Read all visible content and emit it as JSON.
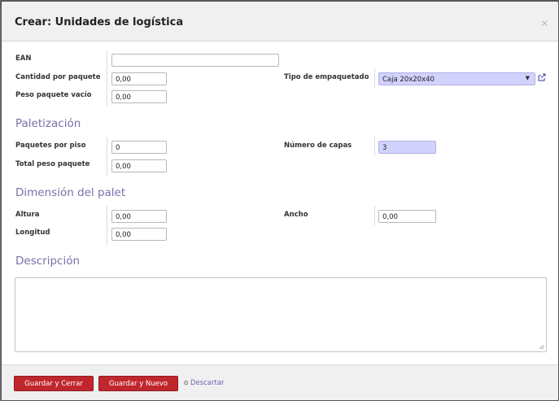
{
  "dialog": {
    "title": "Crear: Unidades de logística",
    "close_label": "×"
  },
  "fields": {
    "ean": {
      "label": "EAN",
      "value": ""
    },
    "cantidad_por_paquete": {
      "label": "Cantidad por paquete",
      "value": "0,00"
    },
    "peso_paquete_vacio": {
      "label": "Peso paquete vacío",
      "value": "0,00"
    },
    "tipo_empaquetado": {
      "label": "Tipo de empaquetado",
      "value": "Caja 20x20x40"
    }
  },
  "paletizacion": {
    "title": "Paletización",
    "paquetes_por_piso": {
      "label": "Paquetes por piso",
      "value": "0"
    },
    "total_peso_paquete": {
      "label": "Total peso paquete",
      "value": "0,00"
    },
    "numero_de_capas": {
      "label": "Número de capas",
      "value": "3"
    }
  },
  "dimension": {
    "title": "Dimensión del palet",
    "altura": {
      "label": "Altura",
      "value": "0,00"
    },
    "longitud": {
      "label": "Longitud",
      "value": "0,00"
    },
    "ancho": {
      "label": "Ancho",
      "value": "0,00"
    }
  },
  "descripcion": {
    "title": "Descripción",
    "value": ""
  },
  "footer": {
    "save_close_label": "Guardar y Cerrar",
    "save_new_label": "Guardar y Nuevo",
    "or_label": "o",
    "discard_label": "Descartar"
  },
  "colors": {
    "primary_button": "#c0272d",
    "section_title": "#7b6fa8",
    "required_field": "#d2d2ff"
  },
  "icons": {
    "external_link": "external-link-icon",
    "dropdown": "chevron-down-icon",
    "resize": "resize-grip-icon"
  }
}
